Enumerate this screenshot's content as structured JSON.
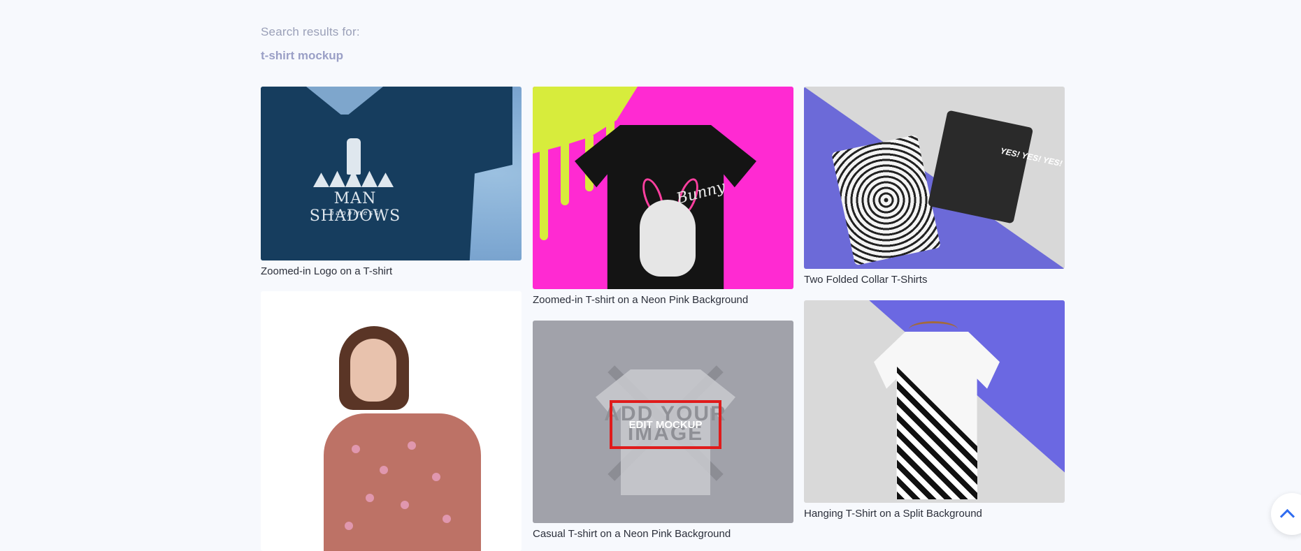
{
  "search": {
    "results_label": "Search results for:",
    "query": "t-shirt mockup"
  },
  "results": [
    {
      "caption": "Zoomed-in Logo on a T-shirt",
      "print_text": "MAN SHADOWS",
      "print_subtext": "happiness"
    },
    {
      "caption": "Zoomed-in T-shirt on a Neon Pink Background",
      "print_text": "Bunny"
    },
    {
      "caption": "Two Folded Collar T-Shirts",
      "print_text": "YES! YES! YES!"
    },
    {
      "caption": ""
    },
    {
      "caption": "Casual T-shirt on a Neon Pink Background",
      "ghost_text": "ADD YOUR IMAGE",
      "button_label": "EDIT MOCKUP"
    },
    {
      "caption": "Hanging T-Shirt on a Split Background"
    }
  ],
  "scroll_top": {
    "icon": "chevron-up-icon"
  },
  "colors": {
    "accent": "#2f6cf0",
    "highlight": "#e01b1b",
    "query": "#9a9fc6"
  }
}
